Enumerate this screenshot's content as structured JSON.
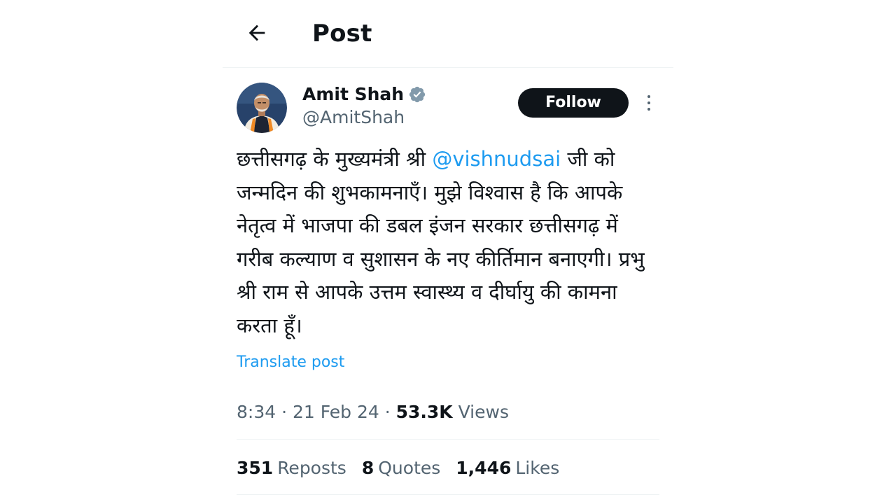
{
  "header": {
    "title": "Post",
    "back_icon": "arrow-left-icon"
  },
  "author": {
    "name": "Amit Shah",
    "handle": "@AmitShah",
    "verified_icon": "verified-badge-icon",
    "verified_color": "#829aab"
  },
  "actions": {
    "follow_label": "Follow",
    "more_icon": "more-vertical-icon"
  },
  "post": {
    "text_before_mention": "छत्तीसगढ़ के मुख्यमंत्री श्री ",
    "mention": "@vishnudsai",
    "text_after_mention": " जी को जन्मदिन की शुभकामनाएँ। मुझे विश्वास है कि आपके नेतृत्व में भाजपा की डबल इंजन सरकार छत्तीसगढ़ में गरीब कल्याण व सुशासन के नए कीर्तिमान बनाएगी। प्रभु श्री राम से आपके उत्तम स्वास्थ्य व दीर्घायु की कामना करता हूँ।",
    "translate_label": "Translate post"
  },
  "meta": {
    "time": "8:34",
    "separator": " · ",
    "date": "21 Feb 24",
    "views_count": "53.3K",
    "views_label": "Views"
  },
  "stats": {
    "reposts_count": "351",
    "reposts_label": "Reposts",
    "quotes_count": "8",
    "quotes_label": "Quotes",
    "likes_count": "1,446",
    "likes_label": "Likes"
  },
  "colors": {
    "text_primary": "#0f1419",
    "text_secondary": "#536471",
    "link": "#1d9bf0",
    "divider": "#eff3f4",
    "follow_bg": "#0f1419"
  }
}
